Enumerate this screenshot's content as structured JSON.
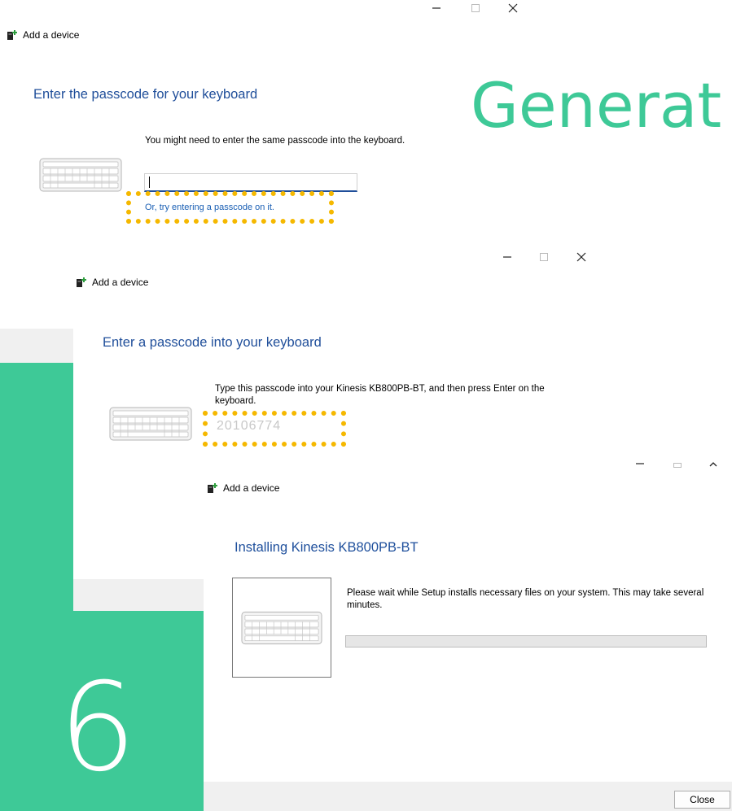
{
  "overlay": {
    "heading_partial": "Generat",
    "step_number": "6"
  },
  "window1": {
    "title": "Add a device",
    "heading": "Enter the passcode for your keyboard",
    "instruction": "You might need to enter the same passcode into the keyboard.",
    "passcode_value": "",
    "alt_link": "Or, try entering a passcode on it."
  },
  "window2": {
    "title": "Add a device",
    "heading": "Enter a passcode into your keyboard",
    "instruction": "Type this passcode into your Kinesis KB800PB-BT, and then press Enter on the keyboard.",
    "passcode": "20106774"
  },
  "window3": {
    "title": "Add a device",
    "heading": "Installing Kinesis KB800PB-BT",
    "instruction": "Please wait while Setup installs necessary files on your system. This may take several minutes.",
    "progress": 0,
    "close_label": "Close"
  },
  "colors": {
    "accent": "#3ec997",
    "heading_blue": "#1f4e9a",
    "highlight": "#f5b800"
  },
  "icons": [
    "add-device-icon",
    "keyboard-icon",
    "minimize-icon",
    "maximize-icon",
    "close-icon",
    "chevron-up-icon"
  ]
}
